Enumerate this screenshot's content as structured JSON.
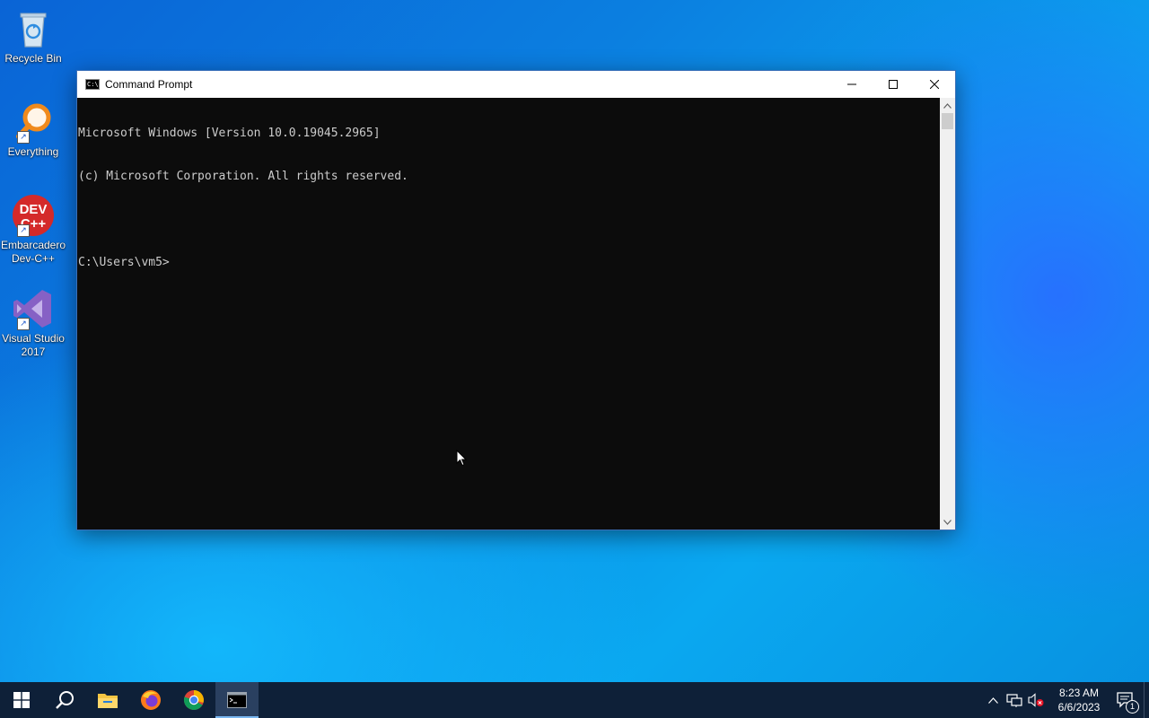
{
  "desktop": {
    "icons": [
      {
        "label": "Recycle Bin",
        "icon": "recycle-bin-icon"
      },
      {
        "label": "Everything",
        "icon": "everything-search-icon"
      },
      {
        "label": "Embarcadero Dev-C++",
        "icon": "dev-cpp-icon",
        "badge": "DEV C++"
      },
      {
        "label": "Visual Studio 2017",
        "icon": "visual-studio-icon"
      }
    ]
  },
  "window": {
    "title": "Command Prompt",
    "icon": "cmd-icon",
    "controls": {
      "minimize": "minimize-icon",
      "maximize": "maximize-icon",
      "close": "close-icon"
    },
    "console_lines": [
      "Microsoft Windows [Version 10.0.19045.2965]",
      "(c) Microsoft Corporation. All rights reserved.",
      "",
      "C:\\Users\\vm5>"
    ]
  },
  "taskbar": {
    "items": [
      {
        "name": "start",
        "icon": "windows-start-icon"
      },
      {
        "name": "search",
        "icon": "search-icon"
      },
      {
        "name": "file-explorer",
        "icon": "folder-icon"
      },
      {
        "name": "firefox",
        "icon": "firefox-icon"
      },
      {
        "name": "chrome",
        "icon": "chrome-icon"
      },
      {
        "name": "command-prompt",
        "icon": "cmd-icon",
        "active": true
      }
    ],
    "tray": {
      "icons": [
        "chevron-up-icon",
        "network-icon",
        "volume-muted-icon"
      ],
      "time": "8:23 AM",
      "date": "6/6/2023",
      "notification_count": "1"
    }
  },
  "colors": {
    "console_bg": "#0c0c0c",
    "console_text": "#cccccc",
    "taskbar_bg": "#0e2038",
    "desktop_accent": "#0a7fe0"
  }
}
